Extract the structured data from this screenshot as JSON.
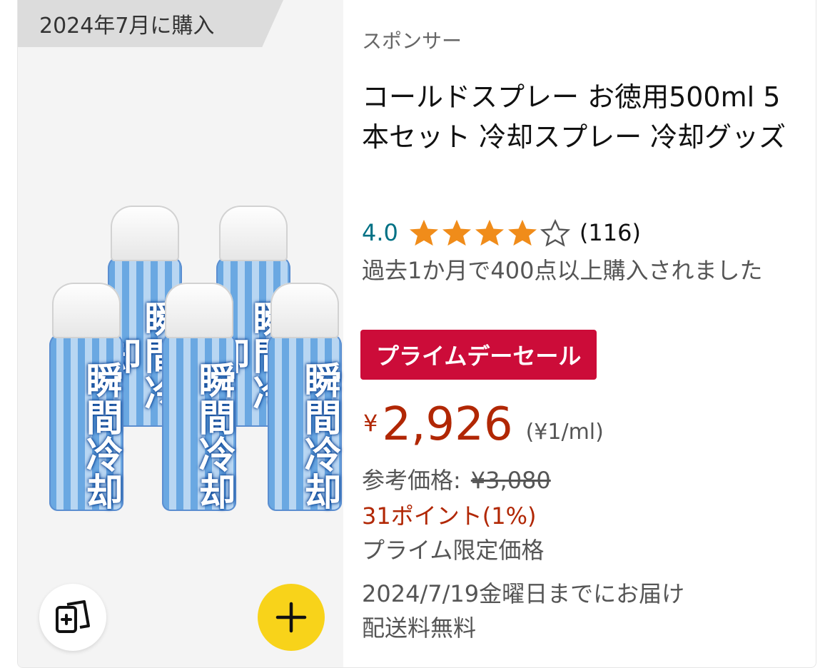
{
  "purchase_badge": "2024年7月に購入",
  "sponsor_label": "スポンサー",
  "product": {
    "title": "コールドスプレー お徳用500ml 5本セット 冷却スプレー 冷却グッズ",
    "image_text": "瞬間冷却",
    "rating": "4.0",
    "stars": 4,
    "review_count": "(116)",
    "bought_text": "過去1か月で400点以上購入されました",
    "deal_badge": "プライムデーセール",
    "currency_symbol": "¥",
    "price": "2,926",
    "unit_price": "(¥1/ml)",
    "ref_price_label": "参考価格:",
    "ref_price": "¥3,080",
    "points": "31ポイント(1%)",
    "prime_limited": "プライム限定価格",
    "delivery": "2024/7/19金曜日までにお届け",
    "shipping": "配送料無料"
  },
  "colors": {
    "deal": "#cc0c39",
    "price": "#b12704",
    "rating": "#007185",
    "star": "#f08c1a",
    "add_button": "#f8d31a"
  },
  "icons": {
    "compare": "compare-cards-icon",
    "add": "plus-icon",
    "star": "star-icon"
  }
}
